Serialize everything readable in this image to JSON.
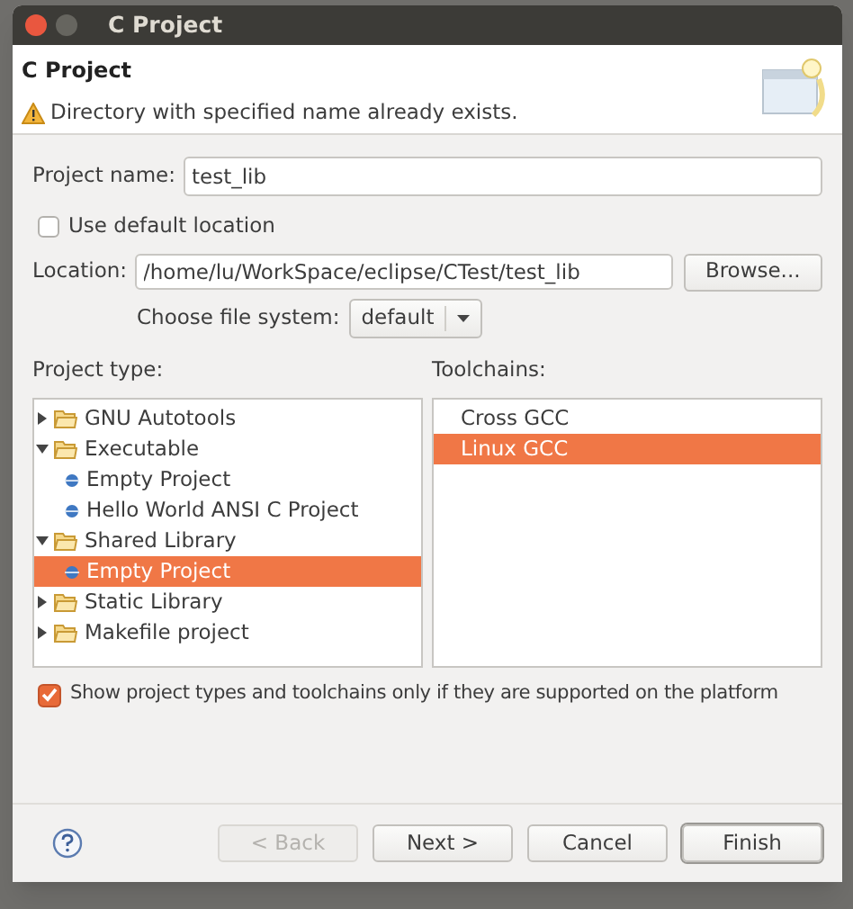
{
  "window": {
    "title": "C Project"
  },
  "header": {
    "title": "C Project",
    "message": "Directory with specified name already exists."
  },
  "project_name": {
    "label": "Project name:",
    "value": "test_lib"
  },
  "use_default_location": {
    "label": "Use default location",
    "checked": false
  },
  "location": {
    "label": "Location:",
    "value": "/home/lu/WorkSpace/eclipse/CTest/test_lib",
    "browse": "Browse..."
  },
  "file_system": {
    "label": "Choose file system:",
    "value": "default"
  },
  "project_type": {
    "label": "Project type:",
    "items": [
      {
        "label": "GNU Autotools",
        "kind": "folder",
        "expanded": false,
        "selected": false
      },
      {
        "label": "Executable",
        "kind": "folder",
        "expanded": true,
        "selected": false,
        "children": [
          {
            "label": "Empty Project",
            "kind": "item",
            "selected": false
          },
          {
            "label": "Hello World ANSI C Project",
            "kind": "item",
            "selected": false
          }
        ]
      },
      {
        "label": "Shared Library",
        "kind": "folder",
        "expanded": true,
        "selected": false,
        "children": [
          {
            "label": "Empty Project",
            "kind": "item",
            "selected": true
          }
        ]
      },
      {
        "label": "Static Library",
        "kind": "folder",
        "expanded": false,
        "selected": false
      },
      {
        "label": "Makefile project",
        "kind": "folder",
        "expanded": false,
        "selected": false
      }
    ]
  },
  "toolchains": {
    "label": "Toolchains:",
    "items": [
      {
        "label": "Cross GCC",
        "selected": false
      },
      {
        "label": "Linux GCC",
        "selected": true
      }
    ]
  },
  "supported_only": {
    "label": "Show project types and toolchains only if they are supported on the platform",
    "checked": true
  },
  "buttons": [
    {
      "label": "< Back",
      "disabled": true,
      "default": false
    },
    {
      "label": "Next >",
      "disabled": false,
      "default": false
    },
    {
      "label": "Cancel",
      "disabled": false,
      "default": false
    },
    {
      "label": "Finish",
      "disabled": false,
      "default": true
    }
  ]
}
